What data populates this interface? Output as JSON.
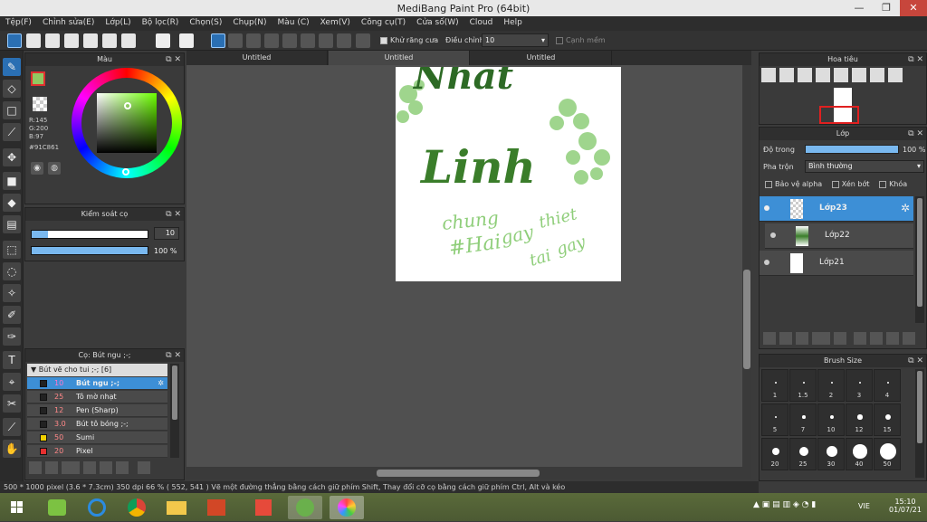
{
  "window": {
    "title": "MediBang Paint Pro (64bit)"
  },
  "menu": [
    "Tệp(F)",
    "Chỉnh sửa(E)",
    "Lớp(L)",
    "Bộ lọc(R)",
    "Chọn(S)",
    "Chụp(N)",
    "Màu (C)",
    "Xem(V)",
    "Công cụ(T)",
    "Cửa số(W)",
    "Cloud",
    "Help"
  ],
  "toolbar": {
    "antialias_label": "Khử răng cưa",
    "correction_label": "Điều chỉnh",
    "correction_value": "10",
    "soft_edge_label": "Cạnh mềm"
  },
  "tabs": [
    "Untitled",
    "Untitled",
    "Untitled"
  ],
  "color_panel": {
    "title": "Màu",
    "r": "R:145",
    "g": "G:200",
    "b": "B:97",
    "hex": "#91C861",
    "fg_color": "#91c861"
  },
  "brush_control": {
    "title": "Kiểm soát cọ",
    "size": "10",
    "opacity": "100 %",
    "size_fill": 0.14,
    "opacity_fill": 1.0
  },
  "brush_panel": {
    "title": "Cọ: Bút ngu ;-;",
    "group": "Bút vẽ cho tui ;-; [6]",
    "items": [
      {
        "size": "10",
        "name": "Bút ngu ;-;",
        "color": "#222222"
      },
      {
        "size": "25",
        "name": "Tô mờ nhạt",
        "color": "#222222"
      },
      {
        "size": "12",
        "name": "Pen (Sharp)",
        "color": "#222222"
      },
      {
        "size": "3.0",
        "name": "Bút tô bóng ;-;",
        "color": "#222222"
      },
      {
        "size": "50",
        "name": "Sumi",
        "color": "#f0d000"
      },
      {
        "size": "20",
        "name": "Pixel",
        "color": "#e83030"
      }
    ]
  },
  "navigator": {
    "title": "Hoa tiêu"
  },
  "layer_panel": {
    "title": "Lớp",
    "opacity_label": "Độ trong",
    "opacity_value": "100 %",
    "blend_label": "Pha trộn",
    "blend_value": "Bình thường",
    "protect_alpha": "Bảo vệ alpha",
    "clipping": "Xén bớt",
    "lock": "Khóa",
    "layers": [
      {
        "name": "Lớp23"
      },
      {
        "name": "Lớp22"
      },
      {
        "name": "Lớp21"
      }
    ]
  },
  "brush_size": {
    "title": "Brush Size",
    "sizes": [
      "1",
      "1.5",
      "2",
      "3",
      "4",
      "5",
      "7",
      "10",
      "12",
      "15",
      "20",
      "25",
      "30",
      "40",
      "50"
    ]
  },
  "canvas_text": [
    "Nhat",
    "Linh",
    "chung",
    "#Hai",
    "gay",
    "thiet",
    "tai",
    "gay"
  ],
  "status": {
    "text": "500 * 1000 pixel   (3.6 * 7.3cm)   350 dpi   66 %   ( 552, 541 )   Vẽ một đường thẳng bằng cách giữ phím Shift, Thay đổi cỡ cọ bằng cách giữ phím Ctrl, Alt và kéo"
  },
  "taskbar": {
    "lang": "VIE",
    "time": "15:10",
    "date": "01/07/21"
  }
}
